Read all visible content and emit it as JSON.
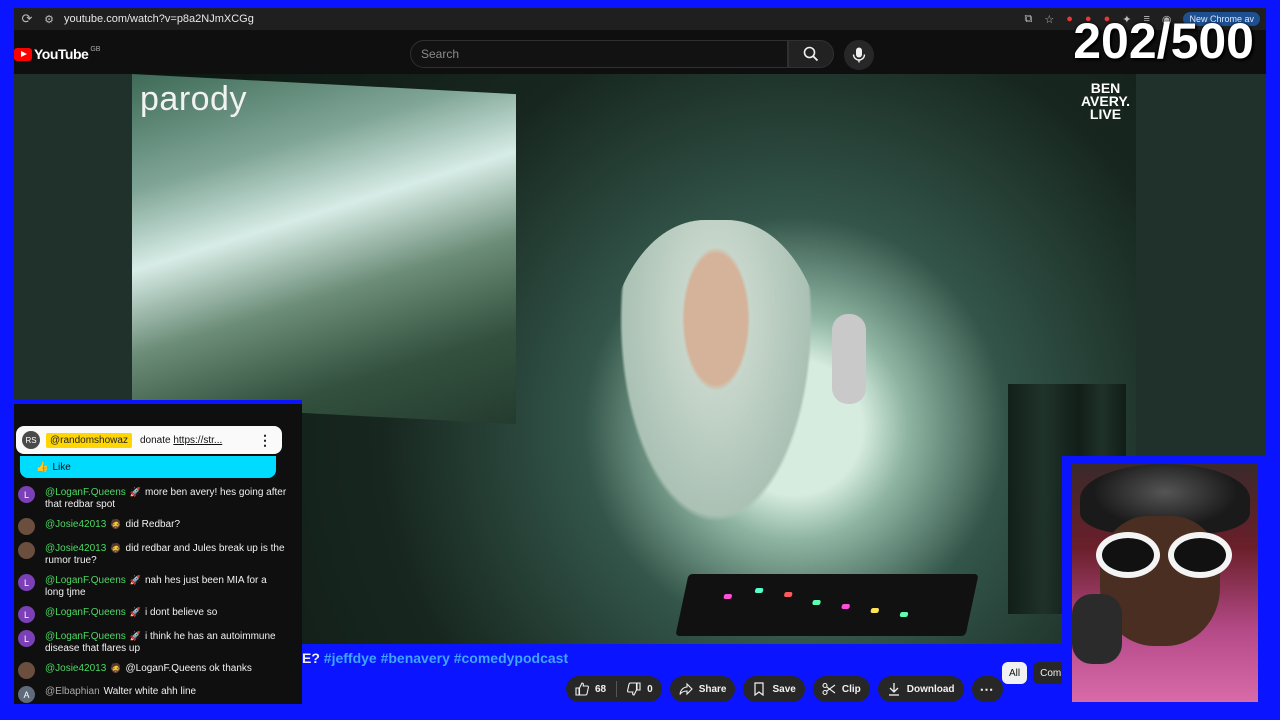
{
  "browser": {
    "url": "youtube.com/watch?v=p8a2NJmXCGg",
    "chrome_badge": "New Chrome av"
  },
  "youtube": {
    "logo_text": "YouTube",
    "region": "GB",
    "search_placeholder": "Search"
  },
  "overlay": {
    "counter": "202/500",
    "parody_label": "parody",
    "watermark": [
      "BEN",
      "AVERY.",
      "LIVE"
    ]
  },
  "video": {
    "title_fragment": "E?",
    "hashtags": "#jeffdye #benavery #comedypodcast"
  },
  "actions": {
    "like_count": "68",
    "dislike_count": "0",
    "share_label": "Share",
    "save_label": "Save",
    "clip_label": "Clip",
    "download_label": "Download"
  },
  "filters": [
    "All",
    "Com"
  ],
  "chat": {
    "pinned": {
      "avatar": "RS",
      "author": "@randomshowaz",
      "message_prefix": "donate",
      "link": "https://str..."
    },
    "like_label": "Like",
    "messages": [
      {
        "initial": "L",
        "avatar_color": "#7b3fb8",
        "author": "@LoganF.Queens",
        "badge": "🚀",
        "text": "more ben avery! hes going after that redbar spot",
        "author_style": "green"
      },
      {
        "initial": "",
        "avatar_color": "#6b4e3d",
        "author": "@Josie42013",
        "badge": "🧔",
        "text": "did Redbar?",
        "author_style": "green"
      },
      {
        "initial": "",
        "avatar_color": "#6b4e3d",
        "author": "@Josie42013",
        "badge": "🧔",
        "text": "did redbar and Jules break up is the rumor true?",
        "author_style": "green"
      },
      {
        "initial": "L",
        "avatar_color": "#7b3fb8",
        "author": "@LoganF.Queens",
        "badge": "🚀",
        "text": "nah hes just been MIA for a long tjme",
        "author_style": "green"
      },
      {
        "initial": "L",
        "avatar_color": "#7b3fb8",
        "author": "@LoganF.Queens",
        "badge": "🚀",
        "text": "i dont believe so",
        "author_style": "green"
      },
      {
        "initial": "L",
        "avatar_color": "#7b3fb8",
        "author": "@LoganF.Queens",
        "badge": "🚀",
        "text": "i think he has an autoimmune disease that flares up",
        "author_style": "green"
      },
      {
        "initial": "",
        "avatar_color": "#6b4e3d",
        "author": "@Josie42013",
        "badge": "🧔",
        "text": "@LoganF.Queens ok thanks",
        "author_style": "green"
      },
      {
        "initial": "A",
        "avatar_color": "#5f6b7a",
        "author": "@Elbaphian",
        "badge": "",
        "text": "Walter white ahh line",
        "author_style": "grey"
      }
    ]
  },
  "colors": {
    "frame_blue": "#0a14ff",
    "chat_name_green": "#4cd964",
    "hashtag_blue": "#3ea6ff",
    "pinned_highlight": "#ffd600",
    "like_bar_cyan": "#00dcff"
  }
}
